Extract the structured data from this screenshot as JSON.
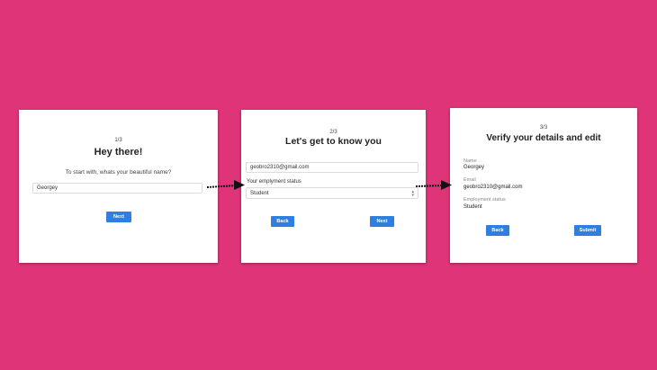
{
  "card1": {
    "step": "1/3",
    "title": "Hey there!",
    "prompt": "To start with, whats your beautiful name?",
    "name_value": "Georgey",
    "next_label": "Next"
  },
  "card2": {
    "step": "2/3",
    "title": "Let's get to know you",
    "email_value": "geobro2310@gmail.com",
    "status_label": "Your emplyment status",
    "status_value": "Student",
    "back_label": "Back",
    "next_label": "Next"
  },
  "card3": {
    "step": "3/3",
    "title": "Verify your details and edit",
    "name_label": "Name",
    "name_value": "Georgey",
    "email_label": "Email",
    "email_value": "geobro2310@gmail.com",
    "status_label": "Employment status",
    "status_value": "Student",
    "back_label": "Back",
    "submit_label": "Submit"
  },
  "colors": {
    "background": "#df3478",
    "button": "#2f7fe0",
    "arrow": "#111111"
  },
  "icons": {
    "select_caret": "chevron-up-down-icon",
    "flow_arrow": "arrow-right-icon"
  }
}
